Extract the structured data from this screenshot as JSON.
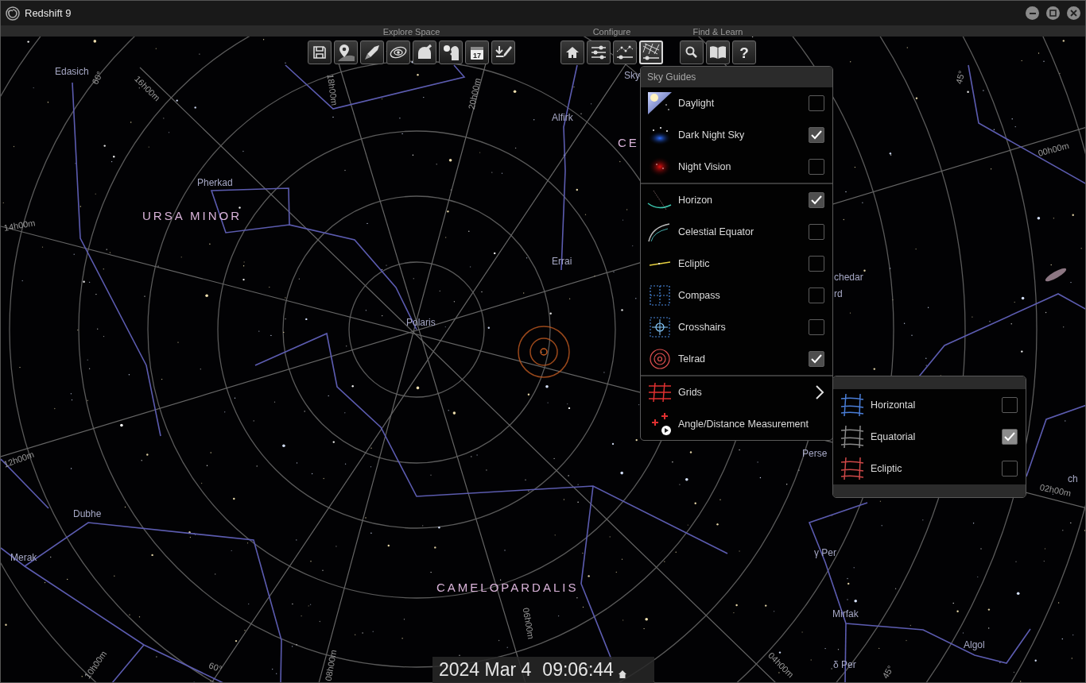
{
  "window": {
    "title": "Redshift 9"
  },
  "toolbar": {
    "groups": [
      {
        "label": "Explore Space",
        "buttons": [
          {
            "kind": "save",
            "selected": false
          },
          {
            "kind": "location",
            "selected": false
          },
          {
            "kind": "rocket",
            "selected": false
          },
          {
            "kind": "orbit",
            "selected": false
          },
          {
            "kind": "observatory",
            "selected": false
          },
          {
            "kind": "profile",
            "selected": false
          },
          {
            "kind": "calendar",
            "glyph": "17",
            "selected": false
          },
          {
            "kind": "export",
            "selected": false
          }
        ]
      },
      {
        "label": "Configure",
        "buttons": [
          {
            "kind": "home",
            "selected": false
          },
          {
            "kind": "sliders",
            "selected": false
          },
          {
            "kind": "constellation",
            "selected": false
          },
          {
            "kind": "grid",
            "selected": true
          }
        ]
      },
      {
        "label": "Find & Learn",
        "buttons": [
          {
            "kind": "search",
            "selected": false
          },
          {
            "kind": "book",
            "selected": false
          },
          {
            "kind": "help",
            "glyph": "?",
            "selected": false
          }
        ]
      }
    ]
  },
  "sky_map": {
    "star_labels": [
      "Edasich",
      "Pherkad",
      "Alfirk",
      "Errai",
      "Polaris",
      "Dubhe",
      "Merak",
      "Sky",
      "chedar",
      "rd",
      "Perse",
      "γ Per",
      "Mirfak",
      "δ Per",
      "Algol",
      "ch"
    ],
    "constellation_labels": [
      "URSA MINOR",
      "CE",
      "CAMELOPARDALIS"
    ],
    "grid_labels": [
      "60°",
      "16h00m",
      "18h00m",
      "20h00m",
      "14h00m",
      "12h00m",
      "10h00m",
      "08h00m",
      "06h00m",
      "04h00m",
      "60°",
      "45°",
      "00h00m",
      "02h00m",
      "45°"
    ]
  },
  "sky_guides_menu": {
    "title": "Sky Guides",
    "sections": [
      {
        "items": [
          {
            "kind": "toggle",
            "label": "Daylight",
            "checked": false
          },
          {
            "kind": "toggle",
            "label": "Dark Night Sky",
            "checked": true
          },
          {
            "kind": "toggle",
            "label": "Night Vision",
            "checked": false
          }
        ]
      },
      {
        "items": [
          {
            "kind": "toggle",
            "label": "Horizon",
            "checked": true
          },
          {
            "kind": "toggle",
            "label": "Celestial Equator",
            "checked": false
          },
          {
            "kind": "toggle",
            "label": "Ecliptic",
            "checked": false
          },
          {
            "kind": "toggle",
            "label": "Compass",
            "checked": false
          },
          {
            "kind": "toggle",
            "label": "Crosshairs",
            "checked": false
          },
          {
            "kind": "toggle",
            "label": "Telrad",
            "checked": true
          }
        ]
      },
      {
        "items": [
          {
            "kind": "submenu",
            "label": "Grids",
            "expanded": true
          },
          {
            "kind": "action",
            "label": "Angle/Distance Measurement"
          }
        ]
      }
    ]
  },
  "grids_submenu": {
    "items": [
      {
        "label": "Horizontal",
        "checked": false
      },
      {
        "label": "Equatorial",
        "checked": true
      },
      {
        "label": "Ecliptic",
        "checked": false
      }
    ]
  },
  "date_bar": {
    "date": "2024 Mar 4",
    "time": "09:06:44"
  }
}
